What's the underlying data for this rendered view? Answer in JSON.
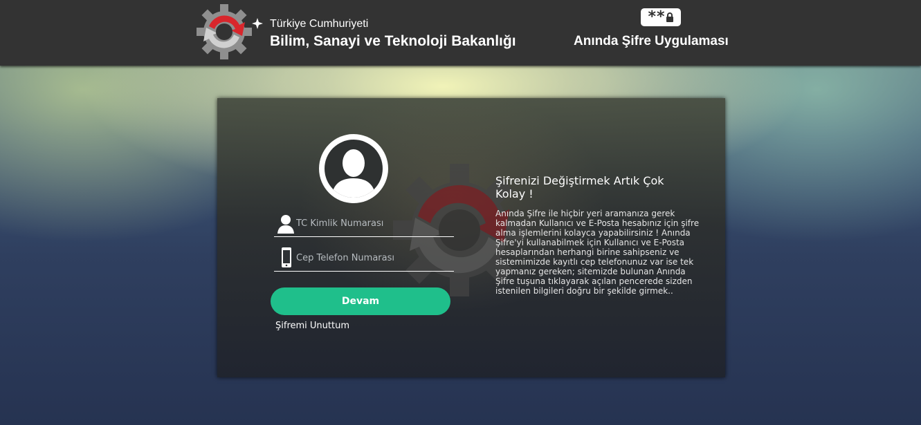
{
  "header": {
    "ministry_line1": "Türkiye Cumhuriyeti",
    "ministry_line2": "Bilim, Sanayi ve Teknoloji Bakanlığı",
    "app_title": "Anında Şifre Uygulaması",
    "badge_icon": "password-lock-icon",
    "colors": {
      "bar": "#333333",
      "logo_red": "#d8262c",
      "logo_gray": "#b9b9b9"
    }
  },
  "login": {
    "tc_placeholder": "TC Kimlik Numarası",
    "phone_placeholder": "Cep Telefon Numarası",
    "submit_label": "Devam",
    "forgot_label": "Şifremi Unuttum",
    "icons": [
      "user-avatar-icon",
      "person-icon",
      "mobile-phone-icon"
    ],
    "accent_color": "#1fbf8b"
  },
  "info": {
    "title": "Şifrenizi Değiştirmek Artık Çok Kolay !",
    "body": "Anında Şifre ile hiçbir yeri aramanıza gerek kalmadan Kullanıcı ve E-Posta hesabınız için şifre alma işlemlerini kolayca yapabilirsiniz ! Anında Şifre'yi kullanabilmek için Kullanıcı ve E-Posta hesaplarından herhangi birine sahipseniz ve sistemimizde kayıtlı cep telefonunuz var ise tek yapmanız gereken; sitemizde bulunan Anında Şifre tuşuna tıklayarak açılan pencerede sizden istenilen bilgileri doğru bir şekilde girmek.."
  }
}
